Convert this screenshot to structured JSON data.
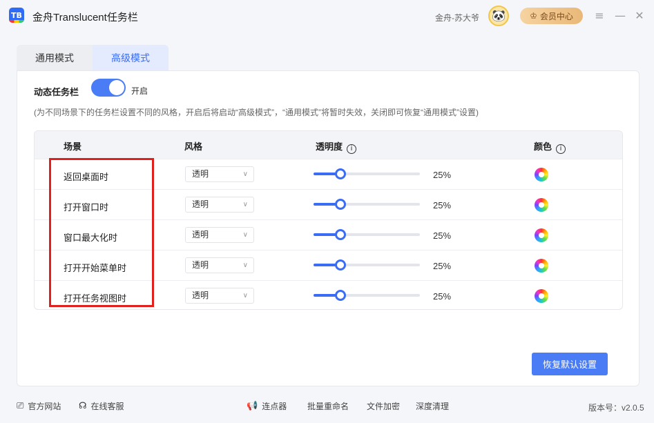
{
  "app": {
    "logo_text": "TB",
    "title": "金舟Translucent任务栏",
    "user_name": "金舟-苏大爷",
    "vip_label": "会员中心"
  },
  "tabs": [
    {
      "label": "通用模式",
      "active": false
    },
    {
      "label": "高级模式",
      "active": true
    }
  ],
  "dynamic": {
    "label": "动态任务栏",
    "toggle_on": true,
    "toggle_label": "开启",
    "hint": "(为不同场景下的任务栏设置不同的风格，开启后将启动“高级模式”，“通用模式”将暂时失效，关闭即可恢复“通用模式”设置)"
  },
  "table": {
    "headers": {
      "scene": "场景",
      "style": "风格",
      "opacity": "透明度",
      "color": "颜色"
    },
    "rows": [
      {
        "scene": "返回桌面时",
        "style": "透明",
        "opacity": 25,
        "opacity_label": "25%"
      },
      {
        "scene": "打开窗口时",
        "style": "透明",
        "opacity": 25,
        "opacity_label": "25%"
      },
      {
        "scene": "窗口最大化时",
        "style": "透明",
        "opacity": 25,
        "opacity_label": "25%"
      },
      {
        "scene": "打开开始菜单时",
        "style": "透明",
        "opacity": 25,
        "opacity_label": "25%"
      },
      {
        "scene": "打开任务视图时",
        "style": "透明",
        "opacity": 25,
        "opacity_label": "25%"
      }
    ]
  },
  "restore_label": "恢复默认设置",
  "footer": {
    "website": "官方网站",
    "service": "在线客服",
    "clicker": "连点器",
    "rename": "批量重命名",
    "encrypt": "文件加密",
    "clean": "深度清理",
    "version": "版本号：v2.0.5"
  },
  "colors": {
    "accent": "#4a7cf6",
    "highlight_border": "#e0201c"
  }
}
